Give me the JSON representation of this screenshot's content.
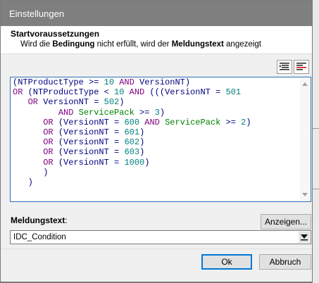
{
  "window": {
    "title": "Einstellungen"
  },
  "header": {
    "title": "Startvoraussetzungen",
    "desc_pre": "Wird die ",
    "desc_bold1": "Bedingung",
    "desc_mid": " nicht erfüllt, wird der ",
    "desc_bold2": "Meldungstext",
    "desc_post": " angezeigt"
  },
  "toolbar": {
    "buttons": [
      {
        "icon": "format-indent-icon"
      },
      {
        "icon": "format-align-icon"
      }
    ]
  },
  "condition": {
    "lines": [
      "(NTProductType >= 10 AND VersionNT)",
      "OR (NTProductType < 10 AND (((VersionNT = 501",
      "   OR VersionNT = 502)",
      "         AND ServicePack >= 3)",
      "      OR (VersionNT = 600 AND ServicePack >= 2)",
      "      OR (VersionNT = 601)",
      "      OR (VersionNT = 602)",
      "      OR (VersionNT = 603)",
      "      OR (VersionNT = 1000)",
      "      )",
      "   )"
    ]
  },
  "message": {
    "label_bold": "Meldungstext",
    "label_rest": ":",
    "show_button": "Anzeigen...",
    "selected_value": "IDC_Condition"
  },
  "footer": {
    "ok_label": "Ok",
    "cancel_label": "Abbruch"
  },
  "colors": {
    "keyword": "#7f007f",
    "number": "#007f7f",
    "identifier": "#00007f",
    "green_identifier": "#007f00",
    "focus_border": "#2d6fb7"
  }
}
